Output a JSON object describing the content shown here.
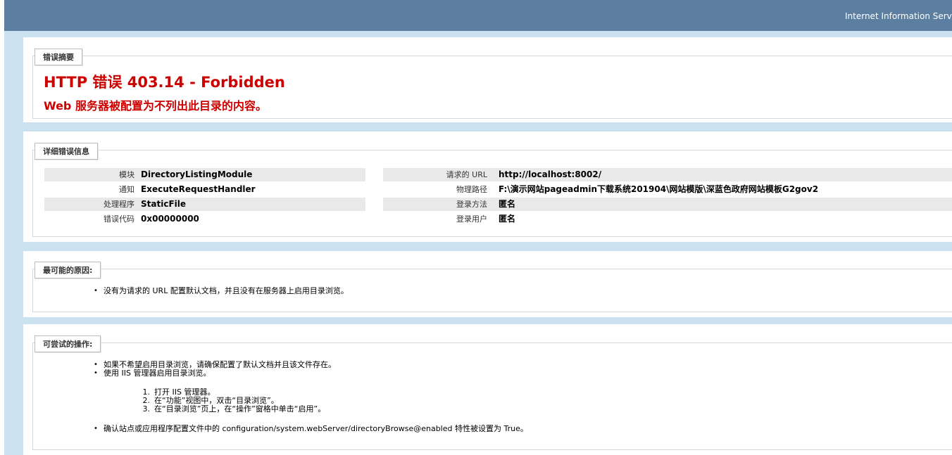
{
  "header": {
    "title": "Internet Information Serv"
  },
  "summary": {
    "legend": "错误摘要",
    "heading": "HTTP 错误 403.14 - Forbidden",
    "subheading": "Web 服务器被配置为不列出此目录的内容。"
  },
  "details": {
    "legend": "详细错误信息",
    "left": [
      {
        "key": "模块",
        "value": "DirectoryListingModule"
      },
      {
        "key": "通知",
        "value": "ExecuteRequestHandler"
      },
      {
        "key": "处理程序",
        "value": "StaticFile"
      },
      {
        "key": "错误代码",
        "value": "0x00000000"
      }
    ],
    "right": [
      {
        "key": "请求的 URL",
        "value": "http://localhost:8002/"
      },
      {
        "key": "物理路径",
        "value": "F:\\演示网站pageadmin下载系统201904\\网站模版\\深蓝色政府网站模板G2gov2"
      },
      {
        "key": "登录方法",
        "value": "匿名"
      },
      {
        "key": "登录用户",
        "value": "匿名"
      }
    ]
  },
  "causes": {
    "legend": "最可能的原因:",
    "items": [
      "没有为请求的 URL 配置默认文档，并且没有在服务器上启用目录浏览。"
    ]
  },
  "actions": {
    "legend": "可尝试的操作:",
    "items": [
      "如果不希望启用目录浏览，请确保配置了默认文档并且该文件存在。",
      "使用 IIS 管理器启用目录浏览。"
    ],
    "steps": [
      {
        "num": "1.",
        "text": "打开 IIS 管理器。"
      },
      {
        "num": "2.",
        "text": "在“功能”视图中，双击“目录浏览”。"
      },
      {
        "num": "3.",
        "text": "在“目录浏览”页上，在“操作”窗格中单击“启用”。"
      }
    ],
    "final_item": "确认站点或应用程序配置文件中的 configuration/system.webServer/directoryBrowse@enabled 特性被设置为 True。"
  }
}
